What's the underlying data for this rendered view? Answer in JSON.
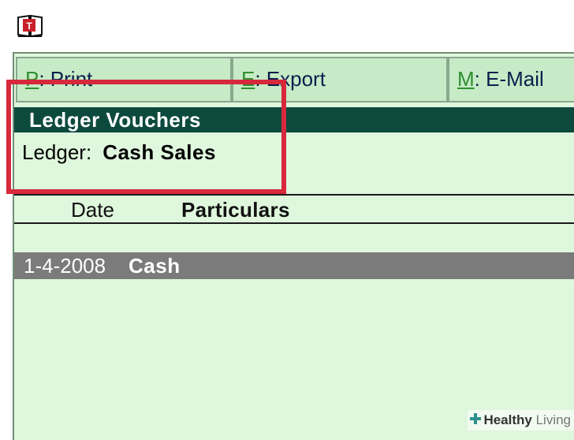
{
  "buttons": {
    "print": {
      "key": "P",
      "label": ": Print"
    },
    "export": {
      "key": "E",
      "label": ": Export"
    },
    "email": {
      "key": "M",
      "label": ": E-Mail"
    }
  },
  "report": {
    "title": "Ledger Vouchers",
    "ledger_label": "Ledger:",
    "ledger_value": "Cash Sales"
  },
  "table": {
    "columns": [
      "Date",
      "Particulars"
    ],
    "rows": [
      {
        "date": "1-4-2008",
        "particulars": "Cash"
      }
    ]
  },
  "watermark": {
    "healthy": "Healthy",
    "living": " Living"
  },
  "colors": {
    "panel_bg": "#dff7dd",
    "button_bg": "#c6ebc6",
    "title_bar": "#0d4a3e",
    "selected_row": "#7b7b7b",
    "highlight": "#d8283c",
    "hotkey": "#2f8f2f"
  },
  "icons": {
    "app": "tally-app-icon",
    "watermark_logo": "cross-logo-icon"
  }
}
